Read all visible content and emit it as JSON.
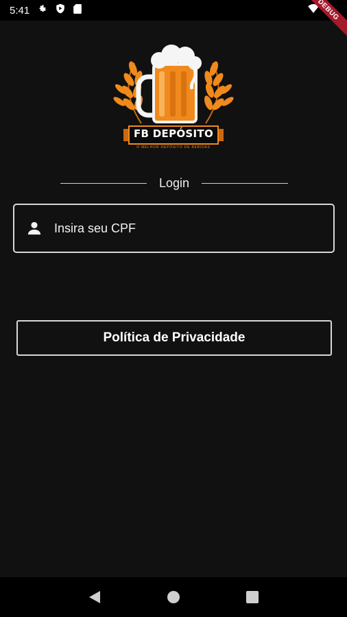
{
  "status_bar": {
    "time": "5:41",
    "icons": [
      "gear-icon",
      "shield-play-icon",
      "sd-card-icon",
      "wifi-icon",
      "battery-icon"
    ]
  },
  "debug_banner": {
    "label": "DEBUG"
  },
  "logo": {
    "brand": "FB DEPÓSITO",
    "tagline": "O MELHOR DEPÓSITO DE BEBIDAS"
  },
  "login": {
    "divider_label": "Login"
  },
  "cpf_field": {
    "placeholder": "Insira seu CPF",
    "value": ""
  },
  "privacy_button": {
    "label": "Política de Privacidade"
  },
  "nav_bar": {
    "icons": [
      "back-icon",
      "home-icon",
      "recents-icon"
    ]
  },
  "colors": {
    "background": "#111111",
    "accent_orange": "#f08a1c",
    "debug_banner": "#a31a2a"
  }
}
